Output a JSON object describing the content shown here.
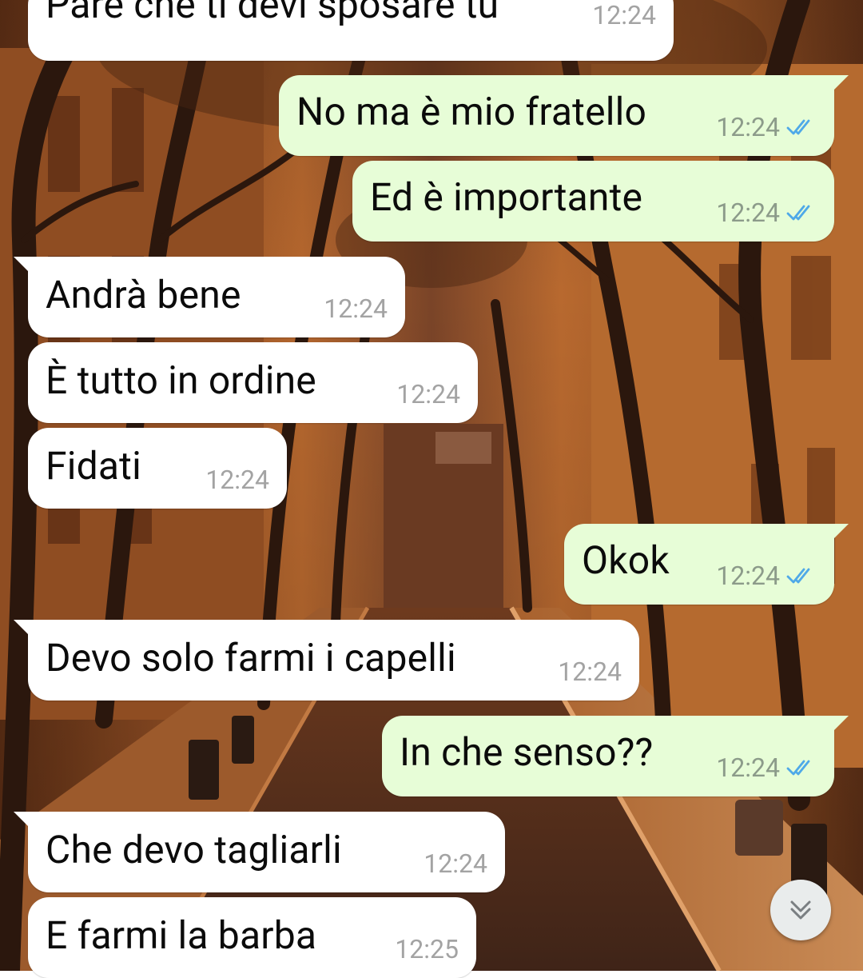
{
  "colors": {
    "incoming_bubble": "#ffffff",
    "outgoing_bubble": "#e7fdd7",
    "timestamp": "#a3a3a3",
    "read_ticks": "#4fa9e8"
  },
  "messages": [
    {
      "direction": "incoming",
      "text": "Pare che ti devi sposare tu",
      "time": "12:24",
      "read": false
    },
    {
      "direction": "outgoing",
      "text": "No ma è mio fratello",
      "time": "12:24",
      "read": true
    },
    {
      "direction": "outgoing",
      "text": "Ed è importante",
      "time": "12:24",
      "read": true
    },
    {
      "direction": "incoming",
      "text": "Andrà bene",
      "time": "12:24",
      "read": false
    },
    {
      "direction": "incoming",
      "text": "È tutto in ordine",
      "time": "12:24",
      "read": false
    },
    {
      "direction": "incoming",
      "text": "Fidati",
      "time": "12:24",
      "read": false
    },
    {
      "direction": "outgoing",
      "text": "Okok",
      "time": "12:24",
      "read": true
    },
    {
      "direction": "incoming",
      "text": "Devo solo farmi i capelli",
      "time": "12:24",
      "read": false
    },
    {
      "direction": "outgoing",
      "text": "In che senso??",
      "time": "12:24",
      "read": true
    },
    {
      "direction": "incoming",
      "text": "Che devo tagliarli",
      "time": "12:24",
      "read": false
    },
    {
      "direction": "incoming",
      "text": "E farmi la barba",
      "time": "12:25",
      "read": false
    }
  ],
  "scroll_down_button": {
    "icon": "double-chevron-down-icon"
  }
}
